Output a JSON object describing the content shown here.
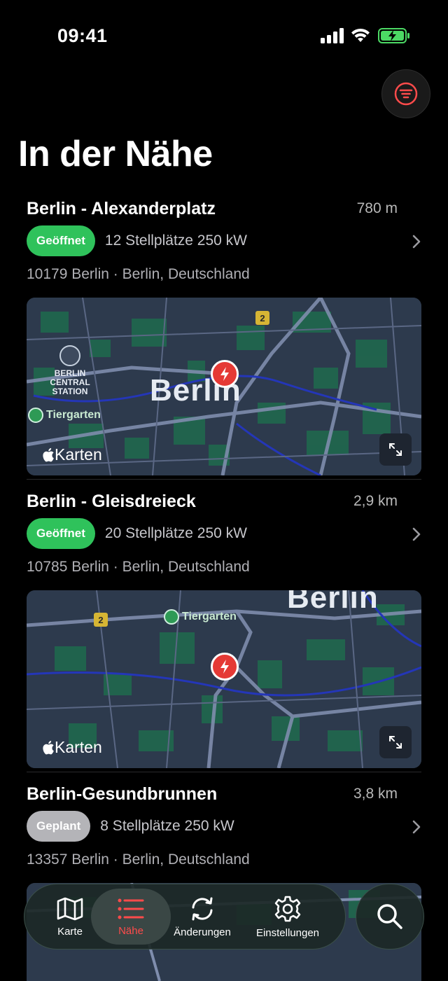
{
  "status_bar": {
    "time": "09:41"
  },
  "header": {
    "title": "In der Nähe"
  },
  "stations": [
    {
      "name": "Berlin - Alexanderplatz",
      "distance": "780 m",
      "status": "Geöffnet",
      "info": "12 Stellplätze  250 kW",
      "address": "10179 Berlin · Berlin, Deutschland",
      "map": {
        "city_label": "Berlin",
        "park_label": "Tiergarten",
        "station_label": "BERLIN\nCENTRAL\nSTATION",
        "road_number": "2",
        "logo": "Karten"
      }
    },
    {
      "name": "Berlin - Gleisdreieck",
      "distance": "2,9 km",
      "status": "Geöffnet",
      "info": "20 Stellplätze  250 kW",
      "address": "10785 Berlin · Berlin, Deutschland",
      "map": {
        "city_label": "Berlin",
        "park_label": "Tiergarten",
        "road_number": "2",
        "logo": "Karten"
      }
    },
    {
      "name": "Berlin-Gesundbrunnen",
      "distance": "3,8 km",
      "status": "Geplant",
      "info": "8 Stellplätze  250 kW",
      "address": "13357 Berlin · Berlin, Deutschland"
    }
  ],
  "tabbar": {
    "tabs": [
      {
        "label": "Karte",
        "icon": "map-icon"
      },
      {
        "label": "Nähe",
        "icon": "list-icon",
        "active": true
      },
      {
        "label": "Änderungen",
        "icon": "refresh-icon"
      },
      {
        "label": "Einstellungen",
        "icon": "gear-icon"
      }
    ]
  },
  "colors": {
    "accent": "#ff4b4b",
    "open": "#2fc25b",
    "planned": "#b4b4b8"
  }
}
